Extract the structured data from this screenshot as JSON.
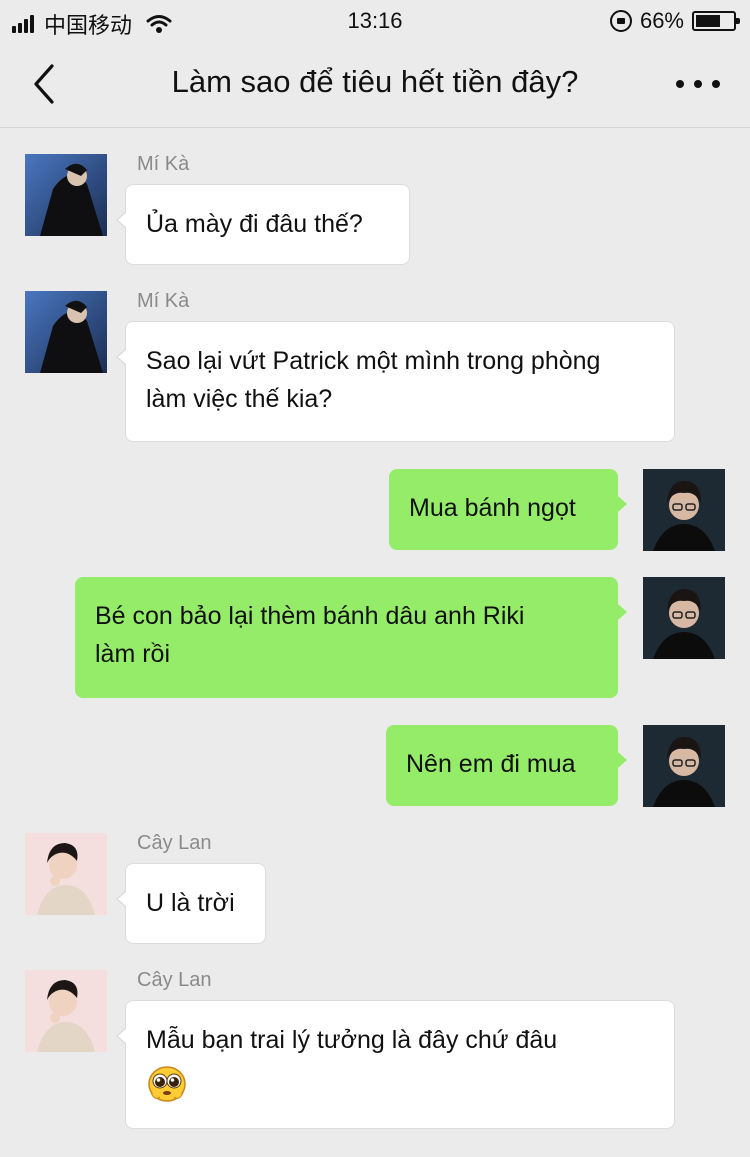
{
  "status_bar": {
    "carrier": "中国移动",
    "time": "13:16",
    "battery_percent_label": "66%",
    "battery_level": 0.66,
    "icons": [
      "signal-icon",
      "wifi-icon",
      "rotation-lock-icon",
      "battery-icon"
    ]
  },
  "nav": {
    "title": "Làm sao để tiêu hết tiền đây?",
    "icons": [
      "back-icon",
      "more-icon"
    ]
  },
  "messages": [
    {
      "side": "in",
      "sender": "Mí Kà",
      "text": "Ủa mày đi đâu thế?"
    },
    {
      "side": "in",
      "sender": "Mí Kà",
      "text": "Sao lại vứt Patrick một mình trong phòng",
      "text2": "làm việc thế kia?"
    },
    {
      "side": "out",
      "text": "Mua bánh ngọt"
    },
    {
      "side": "out",
      "text": "Bé con bảo lại thèm bánh dâu anh Riki",
      "text2": "làm rồi"
    },
    {
      "side": "out",
      "text": "Nên em đi mua"
    },
    {
      "side": "in",
      "sender": "Cây Lan",
      "text": "U là trời"
    },
    {
      "side": "in",
      "sender": "Cây Lan",
      "text": "Mẫu bạn trai lý tưởng là đây chứ đâu",
      "emoji": "pleading-face-emoji"
    }
  ],
  "colors": {
    "background": "#ebebeb",
    "outgoing_bubble": "#95ec69",
    "incoming_bubble": "#ffffff",
    "sender_name": "#8a8a8a"
  }
}
